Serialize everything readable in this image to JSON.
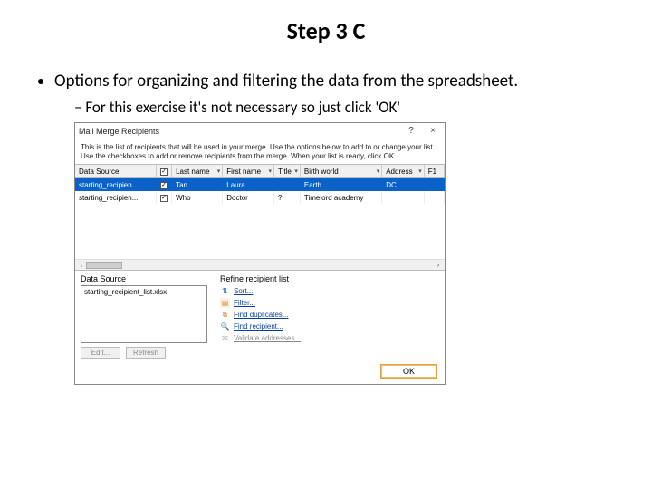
{
  "title": "Step 3 C",
  "bullets": {
    "main": "Options for organizing and filtering the data from the spreadsheet.",
    "sub": "For this exercise it's not necessary so just click 'OK'"
  },
  "dialog": {
    "title": "Mail Merge Recipients",
    "help": "?",
    "close": "×",
    "description": "This is the list of recipients that will be used in your merge. Use the options below to add to or change your list. Use the checkboxes to add or remove recipients from the merge. When your list is ready, click OK.",
    "columns": {
      "datasource": "Data Source",
      "cb": "",
      "lastname": "Last name",
      "firstname": "First name",
      "title": "Title",
      "birthworld": "Birth world",
      "address": "Address",
      "f1": "F1"
    },
    "rows": [
      {
        "ds": "starting_recipien...",
        "checked": true,
        "last": "Tan",
        "first": "Laura",
        "title": "",
        "bw": "Earth",
        "addr": "DC",
        "sel": true
      },
      {
        "ds": "starting_recipien...",
        "checked": true,
        "last": "Who",
        "first": "Doctor",
        "title": "?",
        "bw": "Timelord academy",
        "addr": "",
        "sel": false
      }
    ],
    "dataSourceLabel": "Data Source",
    "dataSourceItem": "starting_recipient_list.xlsx",
    "dsButtons": {
      "edit": "Edit...",
      "refresh": "Refresh"
    },
    "refineLabel": "Refine recipient list",
    "refine": {
      "sort": "Sort...",
      "filter": "Filter...",
      "dup": "Find duplicates...",
      "find": "Find recipient...",
      "validate": "Validate addresses..."
    },
    "ok": "OK"
  }
}
